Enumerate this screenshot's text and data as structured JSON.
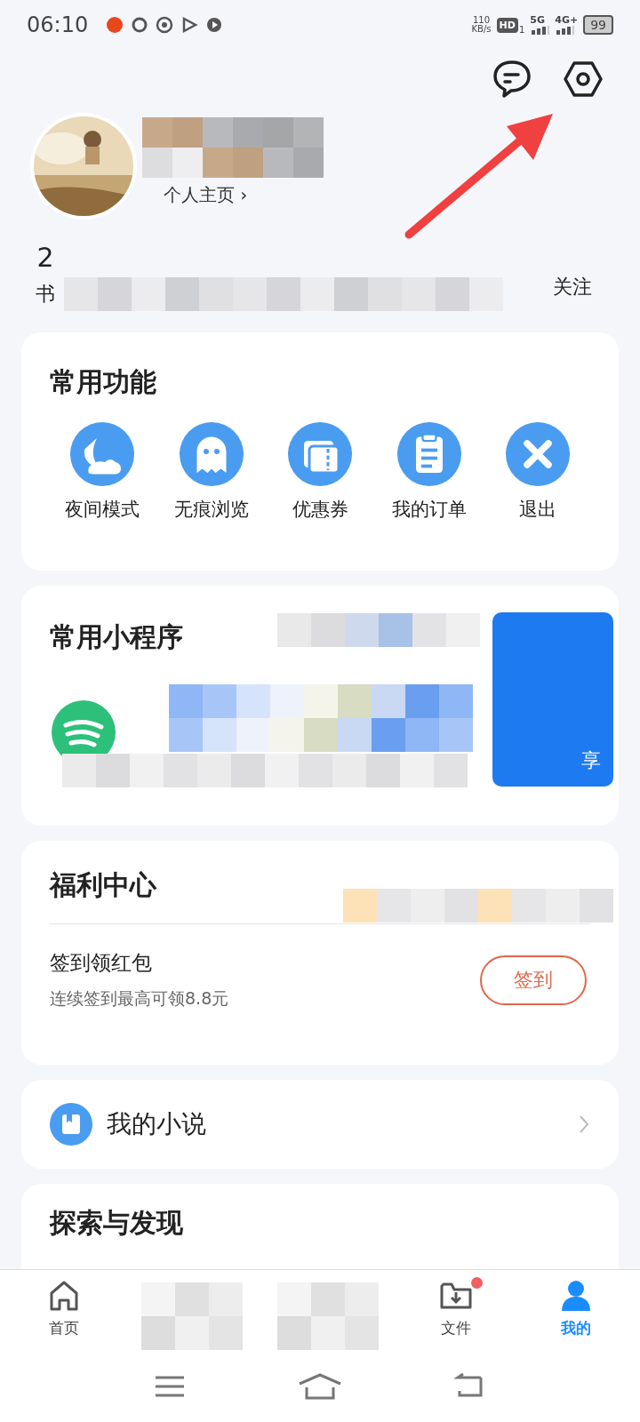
{
  "status_bar": {
    "time": "06:10",
    "net_speed": "110",
    "net_unit": "KB/s",
    "hd": "HD",
    "sim": "1",
    "network_1": "5G",
    "network_2": "4G+",
    "battery": "99"
  },
  "profile": {
    "home_link": "个人主页 ›",
    "stats": [
      {
        "value": "2",
        "label": "书"
      },
      {
        "label": "关注"
      }
    ]
  },
  "functions": {
    "title": "常用功能",
    "items": [
      {
        "label": "夜间模式",
        "kind": "moon"
      },
      {
        "label": "无痕浏览",
        "kind": "ghost"
      },
      {
        "label": "优惠券",
        "kind": "ticket"
      },
      {
        "label": "我的订单",
        "kind": "order"
      },
      {
        "label": "退出",
        "kind": "exit"
      }
    ]
  },
  "mini_programs": {
    "title": "常用小程序",
    "banner_text": "享"
  },
  "welfare": {
    "title": "福利中心",
    "task": "签到领红包",
    "hint": "连续签到最高可领8.8元",
    "button": "签到"
  },
  "novel": {
    "label": "我的小说"
  },
  "explore": {
    "title": "探索与发现"
  },
  "tab_bar": [
    {
      "label": "首页",
      "kind": "home",
      "selected": false,
      "badge": false
    },
    {
      "kind": "obscured"
    },
    {
      "kind": "obscured"
    },
    {
      "label": "文件",
      "kind": "files",
      "selected": false,
      "badge": true
    },
    {
      "label": "我的",
      "kind": "me",
      "selected": true,
      "badge": false
    }
  ]
}
